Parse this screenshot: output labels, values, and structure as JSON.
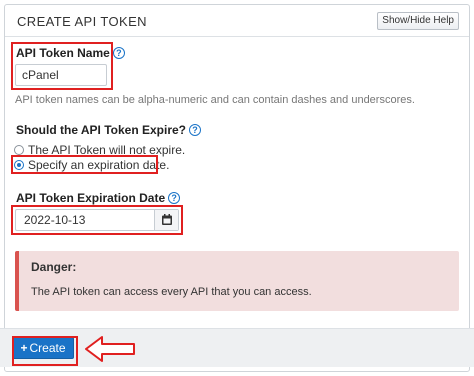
{
  "panel": {
    "title": "CREATE API TOKEN",
    "toggle_help_label": "Show/Hide Help"
  },
  "token_name": {
    "label": "API Token Name",
    "help_icon": "question-circle-icon",
    "value": "cPanel",
    "hint": "API token names can be alpha-numeric and can contain dashes and underscores."
  },
  "expire": {
    "label": "Should the API Token Expire?",
    "help_icon": "question-circle-icon",
    "options": [
      {
        "label": "The API Token will not expire.",
        "selected": false
      },
      {
        "label": "Specify an expiration date.",
        "selected": true
      }
    ]
  },
  "expiration_date": {
    "label": "API Token Expiration Date",
    "help_icon": "question-circle-icon",
    "value": "2022-10-13",
    "picker_icon": "calendar-icon"
  },
  "danger": {
    "title": "Danger:",
    "message": "The API token can access every API that you can access."
  },
  "footer": {
    "create_label": "Create",
    "create_icon": "plus-icon"
  },
  "colors": {
    "primary": "#1a73c7",
    "highlight": "#e02020",
    "danger_bg": "#f2dede"
  }
}
